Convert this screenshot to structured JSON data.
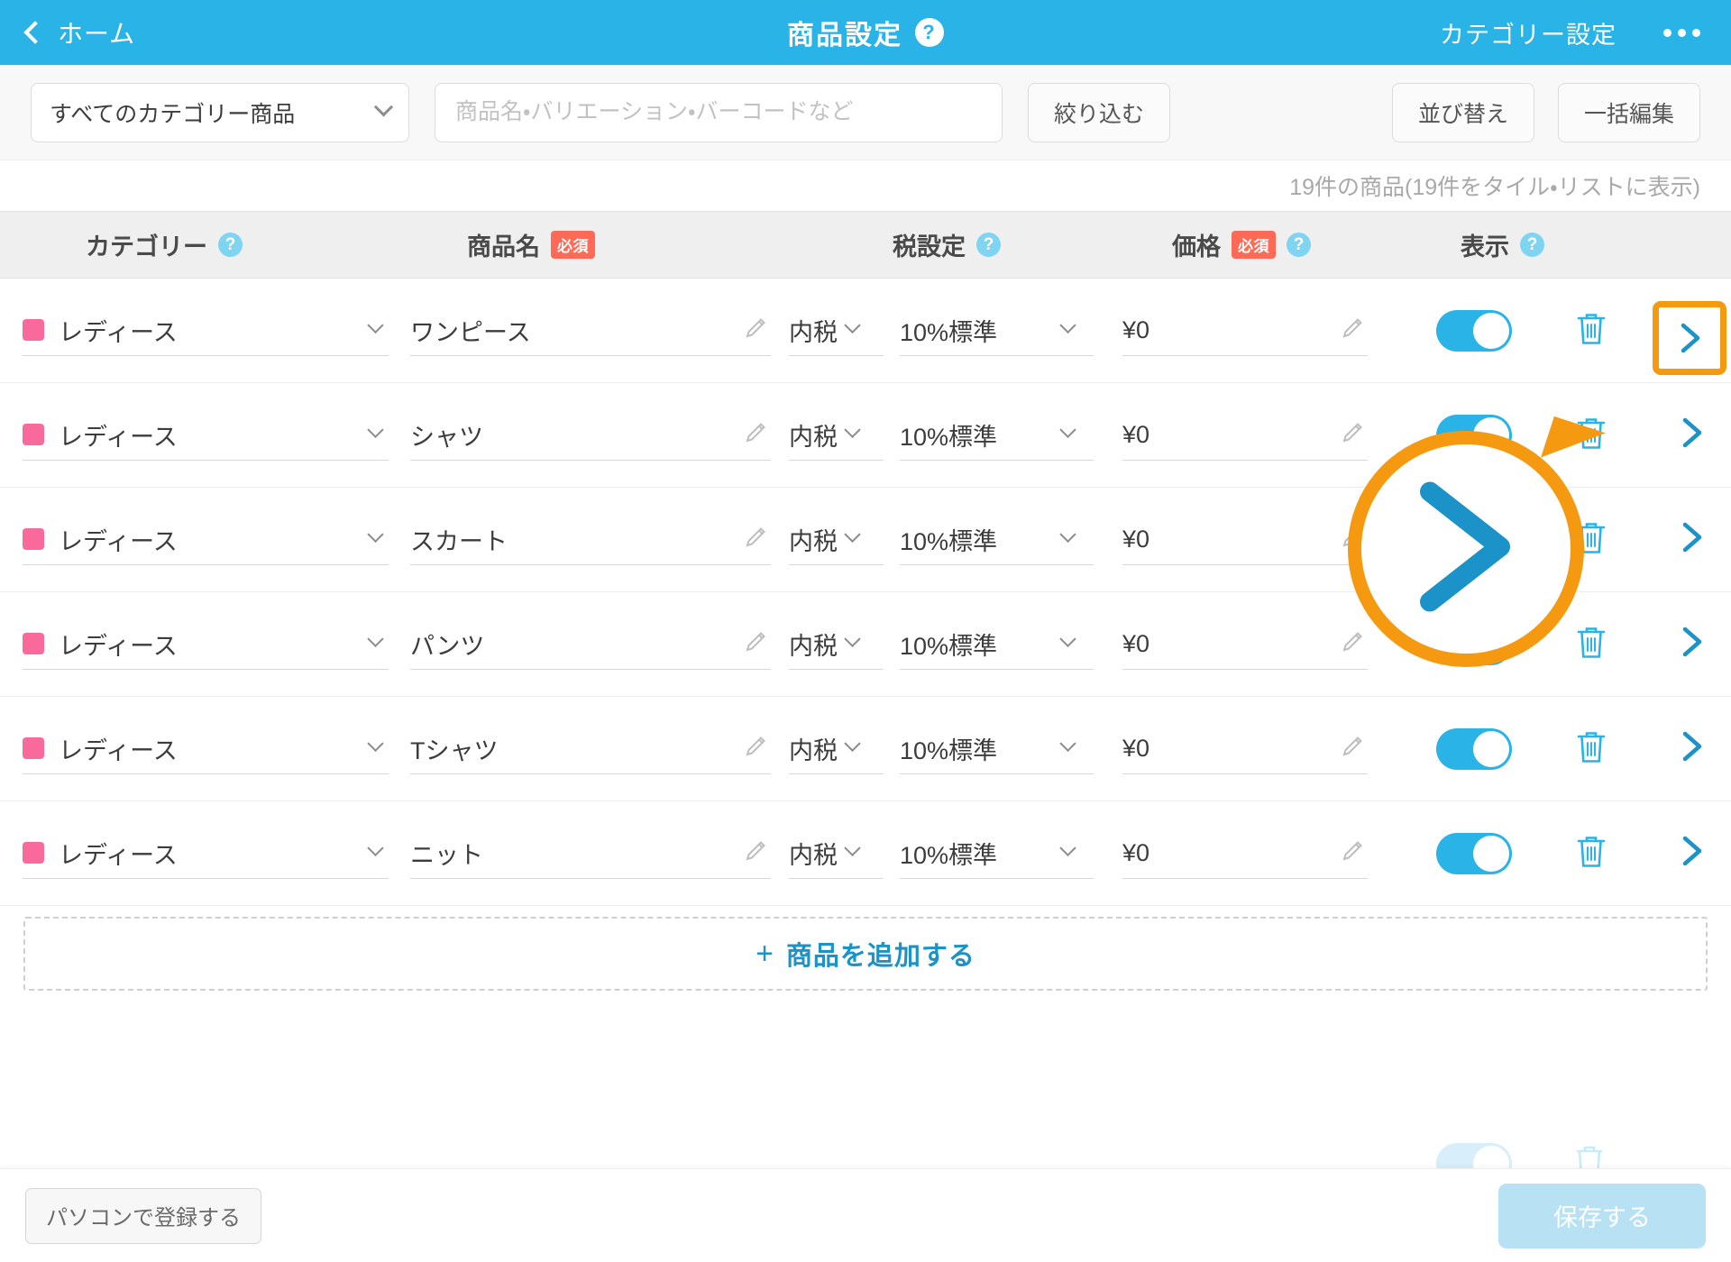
{
  "header": {
    "back_label": "ホーム",
    "back_icon": "chevron-left-icon",
    "title": "商品設定",
    "title_help_icon": "?",
    "category_setting_label": "カテゴリー設定",
    "more_icon": "ellipsis-icon",
    "bg_color": "#29b3e6"
  },
  "toolbar": {
    "category_filter_value": "すべてのカテゴリー商品",
    "search_placeholder": "商品名・バリエーション・バーコードなど",
    "search_value": "",
    "filter_button": "絞り込む",
    "sort_button": "並び替え",
    "bulk_edit_button": "一括編集"
  },
  "count": {
    "text": "19件の商品(19件をタイル・リストに表示)"
  },
  "table": {
    "columns": [
      {
        "label": "カテゴリー",
        "help": true,
        "required": false
      },
      {
        "label": "商品名",
        "help": false,
        "required": true,
        "required_label": "必須"
      },
      {
        "label": "税設定",
        "help": true,
        "required": false
      },
      {
        "label": "価格",
        "help": true,
        "required": true,
        "required_label": "必須"
      },
      {
        "label": "表示",
        "help": true,
        "required": false
      }
    ],
    "rows": [
      {
        "category": "レディース",
        "swatch": "#f9699c",
        "name": "ワンピース",
        "tax_kind": "内税",
        "tax_rate": "10%標準",
        "price": "¥0",
        "visible": true
      },
      {
        "category": "レディース",
        "swatch": "#f9699c",
        "name": "シャツ",
        "tax_kind": "内税",
        "tax_rate": "10%標準",
        "price": "¥0",
        "visible": true
      },
      {
        "category": "レディース",
        "swatch": "#f9699c",
        "name": "スカート",
        "tax_kind": "内税",
        "tax_rate": "10%標準",
        "price": "¥0",
        "visible": true
      },
      {
        "category": "レディース",
        "swatch": "#f9699c",
        "name": "パンツ",
        "tax_kind": "内税",
        "tax_rate": "10%標準",
        "price": "¥0",
        "visible": true
      },
      {
        "category": "レディース",
        "swatch": "#f9699c",
        "name": "Tシャツ",
        "tax_kind": "内税",
        "tax_rate": "10%標準",
        "price": "¥0",
        "visible": true
      },
      {
        "category": "レディース",
        "swatch": "#f9699c",
        "name": "ニット",
        "tax_kind": "内税",
        "tax_rate": "10%標準",
        "price": "¥0",
        "visible": true
      }
    ]
  },
  "add_row": {
    "plus": "+",
    "label": "商品を追加する"
  },
  "footer": {
    "pc_register_label": "パソコンで登録する",
    "save_label": "保存する"
  },
  "annotation": {
    "highlight_color": "#f59a10",
    "magnified_icon": "chevron-right-icon",
    "target": "row-detail-chevron"
  },
  "colors": {
    "accent": "#29b3e6",
    "required_badge": "#ff6a56",
    "category_swatch": "#f9699c",
    "annotation": "#f59a10"
  }
}
